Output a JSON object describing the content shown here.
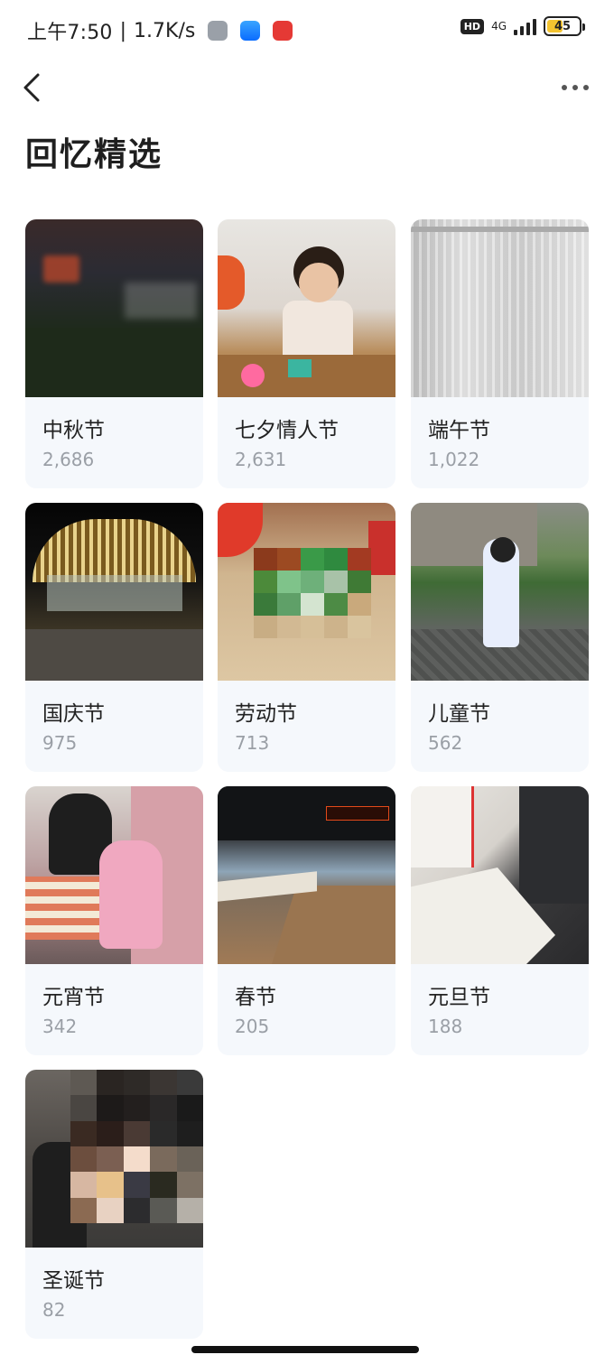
{
  "status_bar": {
    "time": "上午7:50",
    "separator": "|",
    "net_speed": "1.7K/s",
    "hd": "HD",
    "network": "4G",
    "battery": "45",
    "icons": [
      "app-icon-gray",
      "app-icon-blue",
      "app-icon-red"
    ]
  },
  "header": {
    "back_icon": "chevron-left-icon",
    "more_icon": "more-horizontal-icon",
    "title": "回忆精选"
  },
  "albums": [
    {
      "label": "中秋节",
      "count": "2,686"
    },
    {
      "label": "七夕情人节",
      "count": "2,631"
    },
    {
      "label": "端午节",
      "count": "1,022"
    },
    {
      "label": "国庆节",
      "count": "975"
    },
    {
      "label": "劳动节",
      "count": "713"
    },
    {
      "label": "儿童节",
      "count": "562"
    },
    {
      "label": "元宵节",
      "count": "342"
    },
    {
      "label": "春节",
      "count": "205"
    },
    {
      "label": "元旦节",
      "count": "188"
    },
    {
      "label": "圣诞节",
      "count": "82"
    }
  ]
}
